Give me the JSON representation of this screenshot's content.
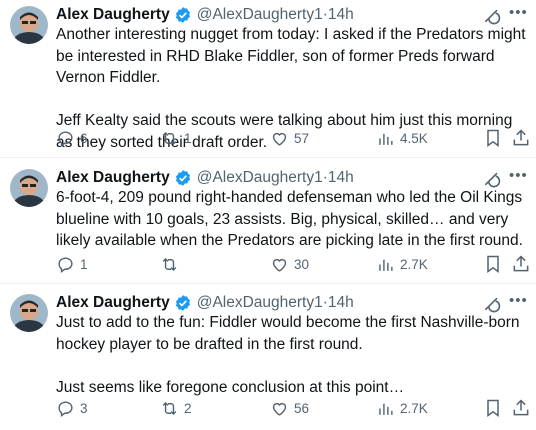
{
  "tweets": [
    {
      "author": "Alex Daugherty",
      "handle": "@AlexDaugherty1",
      "time": "14h",
      "paragraphs": [
        "Another interesting nugget from today: I asked if the Predators might be interested in RHD Blake Fiddler, son of former Preds forward Vernon Fiddler.",
        "Jeff Kealty said the scouts were talking about him just this morning as they sorted their draft order."
      ],
      "replies": "6",
      "reposts": "1",
      "likes": "57",
      "views": "4.5K"
    },
    {
      "author": "Alex Daugherty",
      "handle": "@AlexDaugherty1",
      "time": "14h",
      "paragraphs": [
        "6-foot-4, 209 pound right-handed defenseman who led the Oil Kings blueline with 10 goals, 23 assists. Big, physical, skilled… and very likely available when the Predators are picking late in the first round."
      ],
      "replies": "1",
      "reposts": "",
      "likes": "30",
      "views": "2.7K"
    },
    {
      "author": "Alex Daugherty",
      "handle": "@AlexDaugherty1",
      "time": "14h",
      "paragraphs": [
        "Just to add to the fun: Fiddler would become the first Nashville-born hockey player to be drafted in the first round.",
        "Just seems like foregone conclusion at this point…"
      ],
      "replies": "3",
      "reposts": "2",
      "likes": "56",
      "views": "2.7K"
    }
  ],
  "icons": {
    "verified": "verified-badge-icon",
    "grok": "grok-icon",
    "more": "more-icon",
    "reply": "reply-icon",
    "repost": "repost-icon",
    "like": "like-icon",
    "views": "views-icon",
    "bookmark": "bookmark-icon",
    "share": "share-icon"
  },
  "colors": {
    "verified": "#1d9bf0",
    "secondary": "#536471",
    "text": "#0f1419"
  },
  "separator": " · "
}
